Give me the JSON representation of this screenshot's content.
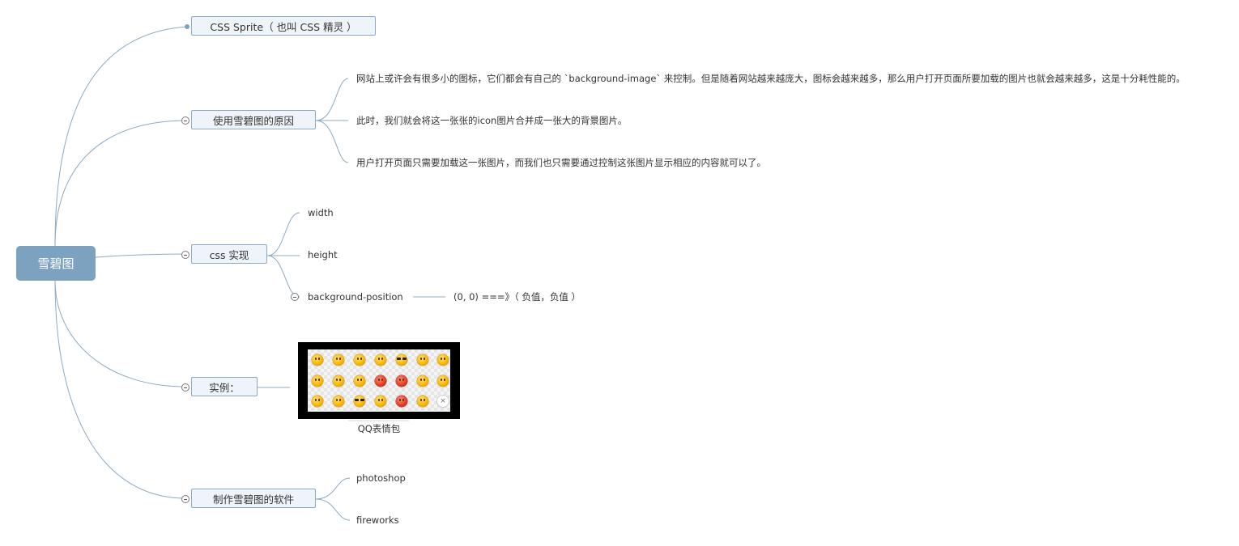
{
  "root": {
    "label": "雪碧图"
  },
  "topics": {
    "sprite": {
      "label": "CSS Sprite（ 也叫 CSS 精灵 ）"
    },
    "reason": {
      "label": "使用雪碧图的原因",
      "items": [
        "网站上或许会有很多小的图标，它们都会有自己的 `background-image` 来控制。但是随着网站越来越庞大，图标会越来越多，那么用户打开页面所要加载的图片也就会越来越多，这是十分耗性能的。",
        "此时，我们就会将这一张张的icon图片合并成一张大的背景图片。",
        "用户打开页面只需要加载这一张图片，而我们也只需要通过控制这张图片显示相应的内容就可以了。"
      ]
    },
    "css": {
      "label": "css 实现",
      "items": [
        "width",
        "height",
        "background-position"
      ],
      "bgpos_detail": "(0, 0) ===》（ 负值，负值 ）"
    },
    "example": {
      "label": "实例：",
      "caption": "QQ表情包"
    },
    "software": {
      "label": "制作雪碧图的软件",
      "items": [
        "photoshop",
        "fireworks"
      ]
    }
  },
  "colors": {
    "accent": "#7da2c0",
    "topic_border": "#8fa9c2",
    "topic_bg": "#eef4f9",
    "line": "#8fa9c2"
  },
  "icons": [
    "collapse-icon",
    "emoji-icon"
  ]
}
